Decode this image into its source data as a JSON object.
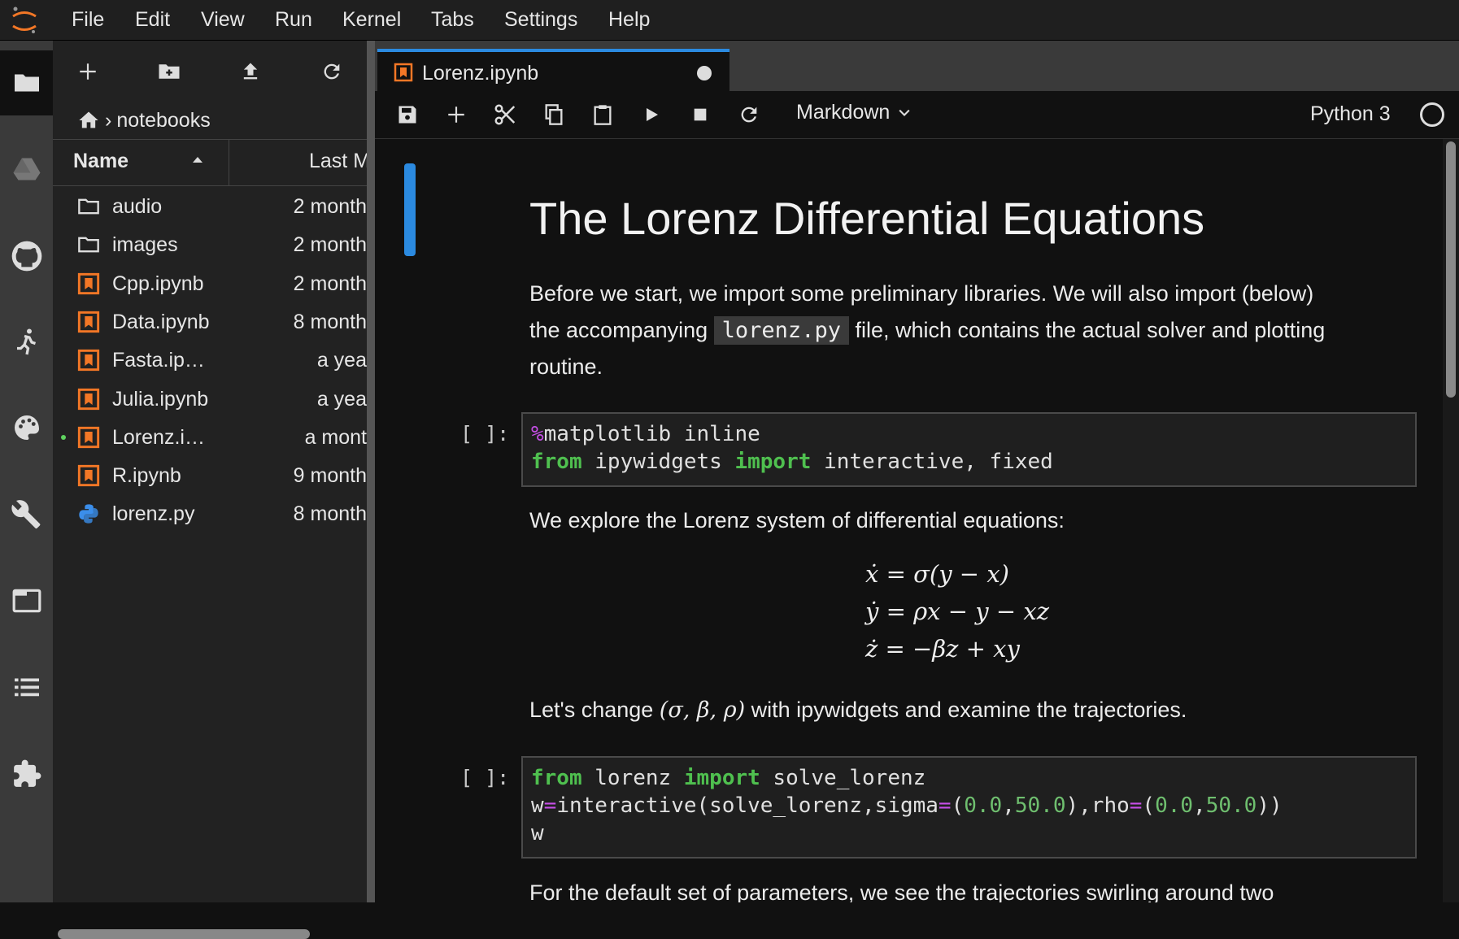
{
  "menubar": {
    "items": [
      "File",
      "Edit",
      "View",
      "Run",
      "Kernel",
      "Tabs",
      "Settings",
      "Help"
    ]
  },
  "activity_bar": {
    "icons": [
      "folder-icon",
      "drive-icon",
      "github-icon",
      "running-icon",
      "palette-icon",
      "wrench-icon",
      "tabs-icon",
      "toc-icon",
      "extension-icon"
    ]
  },
  "file_browser": {
    "breadcrumb": "notebooks",
    "header": {
      "name": "Name",
      "modified": "Last M"
    },
    "files": [
      {
        "name": "audio",
        "modified": "2 month",
        "type": "folder"
      },
      {
        "name": "images",
        "modified": "2 month",
        "type": "folder"
      },
      {
        "name": "Cpp.ipynb",
        "modified": "2 month",
        "type": "notebook"
      },
      {
        "name": "Data.ipynb",
        "modified": "8 month",
        "type": "notebook"
      },
      {
        "name": "Fasta.ip…",
        "modified": "a yea",
        "type": "notebook"
      },
      {
        "name": "Julia.ipynb",
        "modified": "a yea",
        "type": "notebook"
      },
      {
        "name": "Lorenz.i…",
        "modified": "a mont",
        "type": "notebook",
        "running": true
      },
      {
        "name": "R.ipynb",
        "modified": "9 month",
        "type": "notebook"
      },
      {
        "name": "lorenz.py",
        "modified": "8 month",
        "type": "python"
      }
    ]
  },
  "doc_tab": {
    "title": "Lorenz.ipynb"
  },
  "notebook_toolbar": {
    "cell_type": "Markdown",
    "kernel": "Python 3"
  },
  "notebook": {
    "title": "The Lorenz Differential Equations",
    "intro_before": "Before we start, we import some preliminary libraries. We will also import (below)",
    "intro_the": "the accompanying",
    "intro_code": "lorenz.py",
    "intro_after": "file, which contains the actual solver and plotting",
    "intro_end": "routine.",
    "prompt": "[ ]:",
    "cell1": {
      "l1_magic": "%",
      "l1_rest": "matplotlib inline",
      "l2_from": "from",
      "l2_mod": " ipywidgets ",
      "l2_import": "import",
      "l2_rest": " interactive, fixed"
    },
    "explore": "We explore the Lorenz system of differential equations:",
    "eq1": "ẋ = σ(y − x)",
    "eq2": "ẏ = ρx − y − xz",
    "eq3": "ż = −βz + xy",
    "change_before": "Let's change",
    "change_math": "(σ, β, ρ)",
    "change_after": "with ipywidgets and examine the trajectories.",
    "cell2": {
      "l1_from": "from",
      "l1_mod": " lorenz ",
      "l1_import": "import",
      "l1_rest": " solve_lorenz",
      "l2_a": "w",
      "l2_eq1": "=",
      "l2_b": "interactive(solve_lorenz,sigma",
      "l2_eq2": "=",
      "l2_c": "(",
      "l2_n1": "0.0",
      "l2_d": ",",
      "l2_n2": "50.0",
      "l2_e": "),rho",
      "l2_eq3": "=",
      "l2_f": "(",
      "l2_n3": "0.0",
      "l2_g": ",",
      "l2_n4": "50.0",
      "l2_h": "))",
      "l3": "w"
    },
    "trailing": "For the default set of parameters, we see the trajectories swirling around two"
  }
}
